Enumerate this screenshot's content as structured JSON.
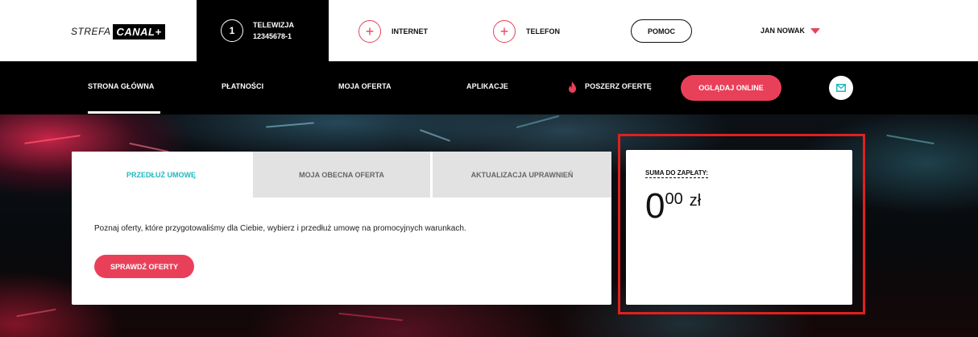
{
  "header": {
    "logo": {
      "prefix": "STREFA",
      "brand": "CANAL+"
    },
    "account": {
      "number": "1",
      "service": "TELEWIZJA",
      "id": "12345678-1"
    },
    "services": [
      {
        "label": "INTERNET",
        "icon": "plus-circle-icon"
      },
      {
        "label": "TELEFON",
        "icon": "plus-circle-icon"
      }
    ],
    "help_label": "POMOC",
    "user_name": "JAN NOWAK"
  },
  "nav": {
    "items": [
      {
        "label": "STRONA GŁÓWNA",
        "active": true
      },
      {
        "label": "PŁATNOŚCI"
      },
      {
        "label": "MOJA OFERTA"
      },
      {
        "label": "APLIKACJE"
      },
      {
        "label": "POSZERZ OFERTĘ",
        "icon": "fire-icon"
      }
    ],
    "watch_online_label": "OGLĄDAJ ONLINE",
    "mail_icon": "mail-icon"
  },
  "main": {
    "tabs": [
      {
        "label": "PRZEDŁUŻ UMOWĘ",
        "active": true
      },
      {
        "label": "MOJA OBECNA OFERTA"
      },
      {
        "label": "AKTUALIZACJA UPRAWNIEŃ"
      }
    ],
    "description": "Poznaj oferty, które przygotowaliśmy dla Ciebie, wybierz i przedłuż umowę na promocyjnych warunkach.",
    "cta_label": "SPRAWDŹ OFERTY"
  },
  "summary": {
    "label": "SUMA DO ZAPŁATY:",
    "amount_int": "0",
    "amount_dec": "00",
    "currency": "zł"
  },
  "colors": {
    "accent": "#e9405a",
    "active_tab": "#1fb8c0",
    "highlight_frame": "#e0201e"
  }
}
